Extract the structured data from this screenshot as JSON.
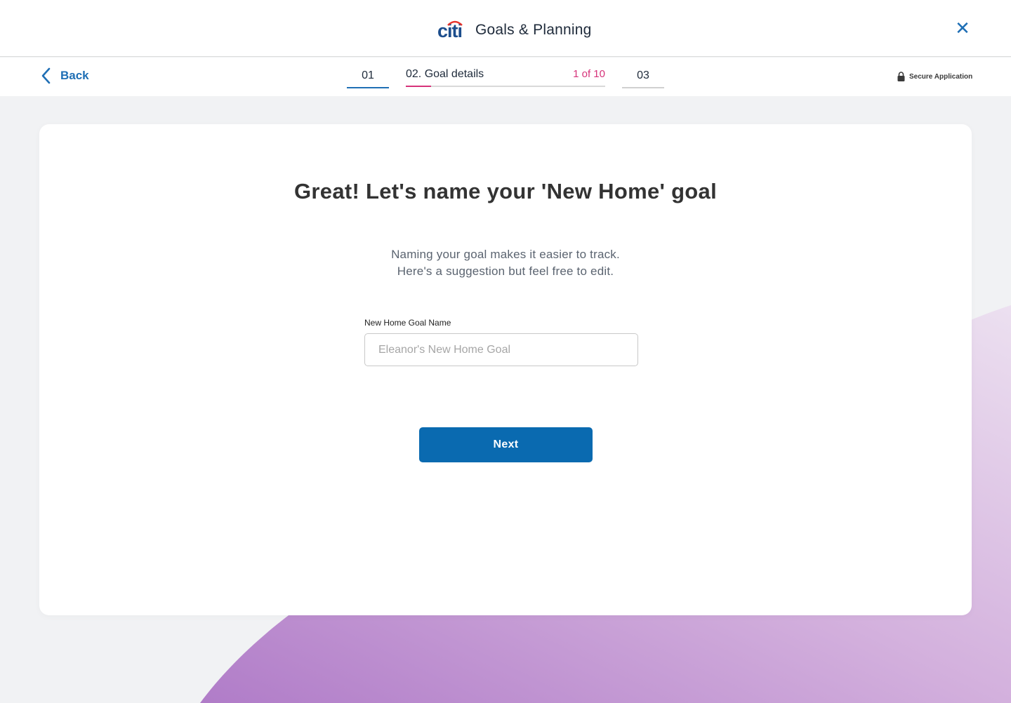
{
  "header": {
    "brand": "citi",
    "title": "Goals & Planning",
    "close_symbol": "✕"
  },
  "stepbar": {
    "back_label": "Back",
    "steps": [
      {
        "label": "01",
        "state": "completed"
      },
      {
        "label": "02. Goal details",
        "progress_text": "1 of 10",
        "progress_fraction": 0.1,
        "state": "active"
      },
      {
        "label": "03",
        "state": "upcoming"
      }
    ],
    "secure_label": "Secure Application"
  },
  "main": {
    "headline": "Great! Let's name your 'New Home' goal",
    "description_line1": "Naming your goal makes it easier to track.",
    "description_line2": "Here's a suggestion but feel free to edit.",
    "goal_name_field": {
      "label": "New Home Goal Name",
      "value": "",
      "placeholder": "Eleanor's New Home Goal"
    },
    "next_label": "Next"
  },
  "colors": {
    "brand_blue": "#0a6ab0",
    "accent_pink": "#d6337a",
    "decor_purple": "#b888cc"
  },
  "icons": [
    "citi-logo-icon",
    "close-icon",
    "chevron-left-icon",
    "lock-icon"
  ]
}
